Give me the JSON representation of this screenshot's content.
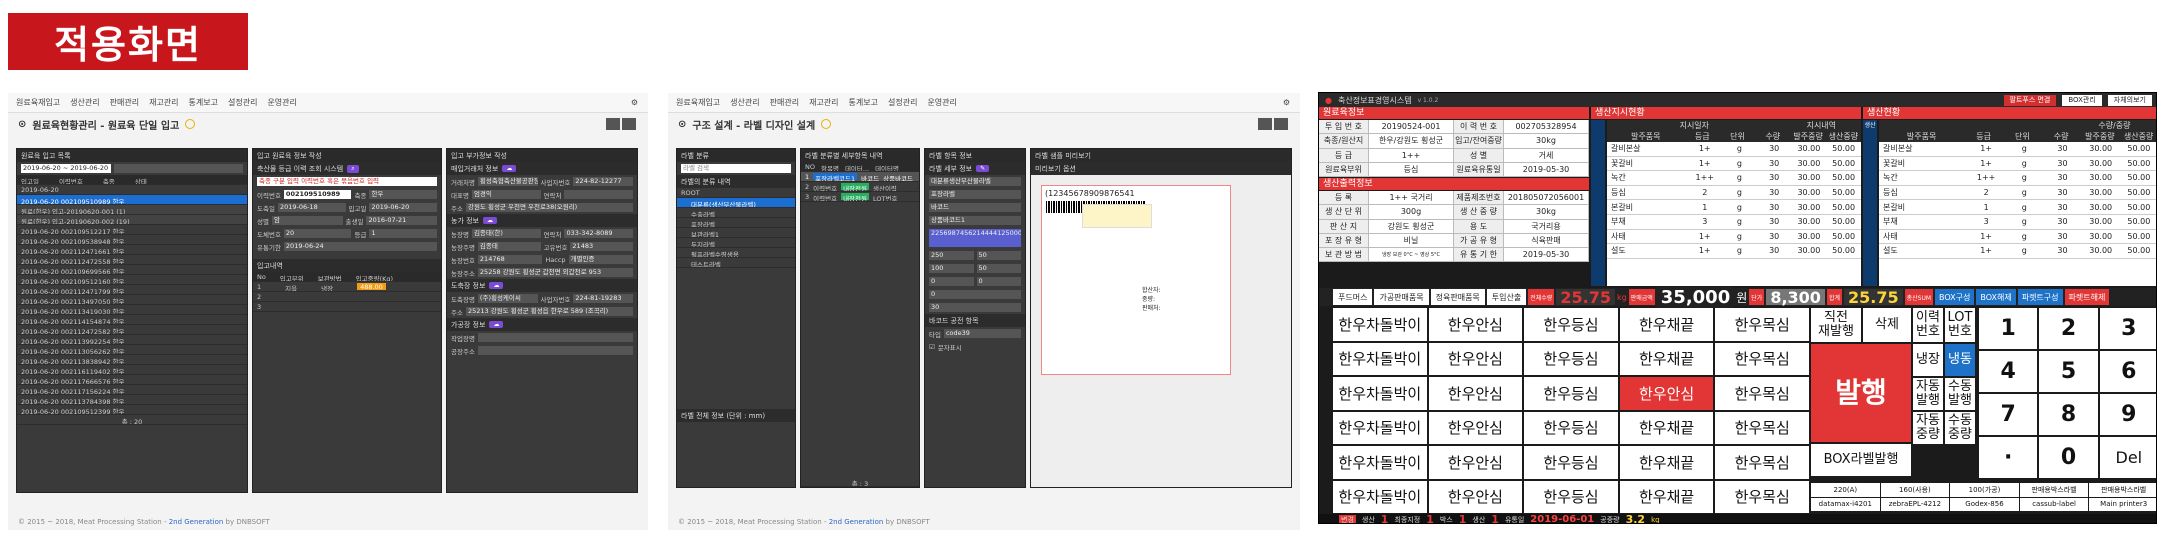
{
  "heading": "적용화면",
  "shot1": {
    "nav": [
      "원료육재입고",
      "생산관리",
      "판매관리",
      "재고관리",
      "통계보고",
      "설정관리",
      "운영관리"
    ],
    "title": "원료육현황관리 - 원료육 단일 입고",
    "left_title": "원료육 입고 목록",
    "date_range": "2019-06-20 ~ 2019-06-20",
    "cols": [
      "입고일",
      "이력번호",
      "축종",
      "상태"
    ],
    "rows": [
      "2019-06-20",
      "2019-06-20   002109510989   한우",
      "원료(한우) 입고-20190620-001 (1)",
      "원료(한우) 입고-20190620-002 (19)",
      "2019-06-20   002109512217   한우",
      "2019-06-20   002109538948   한우",
      "2019-06-20   002112471661   한우",
      "2019-06-20   002112472558   한우",
      "2019-06-20   002109699566   한우",
      "2019-06-20   002109512160   한우",
      "2019-06-20   002112471799   한우",
      "2019-06-20   002113497050   한우",
      "2019-06-20   002113419030   한우",
      "2019-06-20   002114154874   한우",
      "2019-06-20   002112472582   한우",
      "2019-06-20   002113992254   한우",
      "2019-06-20   002113056262   한우",
      "2019-06-20   002113838942   한우",
      "2019-06-20   002116119402   한우",
      "2019-06-20   002117666576   한우",
      "2019-06-20   002117156224   한우",
      "2019-06-20   002113784398   한우",
      "2019-06-20   002109512399   한우"
    ],
    "total": "총 : 20",
    "mid_title": "입고 원료육 정보 작성",
    "mid_sub": "축산물 등급 이력 조회 시스템",
    "search_hint": "축종 구분 입력 이력번호 혹은 묶음번호 입력",
    "trace_no": "002109510989",
    "fields": [
      [
        "이력번호",
        "002109510989",
        "축종",
        "한우"
      ],
      [
        "도축일",
        "2019-06-18",
        "입고일",
        "2019-06-20"
      ],
      [
        "성별",
        "암",
        "출생일",
        "2016-07-21"
      ],
      [
        "도체번호",
        "20",
        "등급",
        "1"
      ],
      [
        "유통기한",
        "2019-06-24",
        "",
        " "
      ]
    ],
    "lines_head": [
      "No",
      "입고부위",
      "보관방법",
      "입고중량(Kg)"
    ],
    "lines": [
      [
        "1",
        "지육",
        "냉장",
        "488.00"
      ],
      [
        "2",
        "",
        "",
        " "
      ],
      [
        "3",
        "",
        "",
        ""
      ]
    ],
    "right_title": "입고 부가정보 작성",
    "r1": "매입거래처 정보",
    "r2": "농가 정보",
    "r3": "도축장 정보",
    "r4": "가공장 정보",
    "rfields": [
      [
        "거래처명",
        "횡성축협축산물공판장",
        "사업자번호",
        "224-82-12277"
      ],
      [
        "대표명",
        "엄경익",
        "연락처",
        ""
      ],
      [
        "주소",
        "강원도 횡성군 우천면 우천로38(오원리)",
        "",
        " "
      ],
      [
        "농장명",
        "김종태(한)",
        "연락처",
        "033-342-8089"
      ],
      [
        "농장주명",
        "김종태",
        "고유번호",
        "21483"
      ],
      [
        "농장번호",
        "214768",
        "Haccp",
        "개별인증"
      ],
      [
        "농장주소",
        "25258 강원도 횡성군 갑천면 외갑천로 953",
        "",
        " "
      ],
      [
        "도축장명",
        "(주)횡성케이씨",
        "사업자번호",
        "224-81-19283"
      ],
      [
        "주소",
        "25213 강원도 횡성군 횡성읍 한우로 589 (조곡리)",
        "",
        " "
      ],
      [
        "작업장명",
        "",
        "",
        ""
      ],
      [
        "공장주소",
        "",
        "",
        ""
      ]
    ],
    "footer_pre": "© 2015 ~ 2018, Meat Processing Station - ",
    "footer_brand": "2nd Generation",
    "footer_post": " by DNBSOFT"
  },
  "shot2": {
    "nav": [
      "원료육재입고",
      "생산관리",
      "판매관리",
      "재고관리",
      "통계보고",
      "설정관리",
      "운영관리"
    ],
    "title": "구조 설계 - 라벨 디자인 설계",
    "p1": "라벨 분류",
    "search": "라벨 검색",
    "p1b": "라벨의 분류 내역",
    "tree": [
      "ROOT",
      "대분류(생산부산물라벨)",
      "수출라벨",
      "포장라벨",
      "보관라벨1",
      "두지라벨",
      "펄프라벨수령생용",
      "테스트라벨"
    ],
    "p2": "라벨 분류별 세부항목 내역",
    "p2cols": [
      "NO",
      "항목명",
      "데이터...",
      "데이터명"
    ],
    "p2rows": [
      [
        "1",
        "포장라벨코드1",
        "바코드",
        "상품바코드"
      ],
      [
        "2",
        "이력번호",
        "내장전원",
        "생산이력"
      ],
      [
        "3",
        "이력번호",
        "내장전원",
        "LOT번호"
      ]
    ],
    "p3": "라벨 항목 정보",
    "p3b": "라벨 세부 정보",
    "p3fields": [
      "대분류생산부산물라벨",
      "포장라벨",
      "바코드",
      "상품바코드1",
      "2256987456214444125000",
      "250",
      "100",
      "0",
      "0",
      "30",
      "50",
      "50",
      "0",
      "code39"
    ],
    "p3f": "바코드 공전 항목",
    "p3type": "타입",
    "p3show": "문자표시",
    "p4": "라벨 샘플 미리보기",
    "p4sub": "미리보기 옵션",
    "barcode": "(12345678909876541",
    "sample": [
      "합산자:",
      "중량:",
      "판매처:"
    ],
    "pgrid": "라벨 전체 정보 (단위 : mm)",
    "count": "총 : 3",
    "footer_pre": "© 2015 ~ 2018, Meat Processing Station - ",
    "footer_brand": "2nd Generation",
    "footer_post": " by DNBSOFT"
  },
  "shot3": {
    "title": "축산정보표경영시스템",
    "ver": "v 1.0.2",
    "btn_user": "팔트푸스 면결",
    "btn_box": "BOX관리",
    "btn_save": "자체의보기",
    "sec_raw": "원료육정보",
    "sec_plan": "생산지시현황",
    "sec_prod": "생산현황",
    "sec_out": "생산출력정보",
    "raw": [
      [
        "투 입 번 호",
        "20190524-001",
        "이 력 번 호",
        "002705328954"
      ],
      [
        "축종/원산지",
        "한우/강원도 횡성군",
        "입고/잔여중량",
        "30kg"
      ],
      [
        "등    급",
        "1++",
        "성      별",
        "거세"
      ],
      [
        "원료육부위",
        "등심",
        "원료육유통일",
        "2019-05-30"
      ]
    ],
    "out": [
      [
        "등    록",
        "1++ 국거리",
        "제품제조번호",
        "201805072056001"
      ],
      [
        "생 산 단 위",
        "300g",
        "생 산 중 량",
        "30kg"
      ],
      [
        "판    산  지",
        "강원도 횡성군",
        "용     도",
        "국거리용"
      ],
      [
        "포 장 유 형",
        "비닐",
        "가 공 유 형",
        "식육판매"
      ],
      [
        "보 관 방 법",
        "냉장 보관 0°C ~ 영상 5°C",
        "유 통 기 한",
        "2019-05-30"
      ]
    ],
    "plan_cols": [
      "발주품목",
      "등급",
      "단위",
      "수량",
      "발주중량",
      "생산중량"
    ],
    "plan": [
      [
        "갈비본살",
        "1+",
        "g",
        "30",
        "30.00",
        "50.00"
      ],
      [
        "꽃갈비",
        "1+",
        "g",
        "30",
        "30.00",
        "50.00"
      ],
      [
        "녹간",
        "1++",
        "g",
        "30",
        "30.00",
        "50.00"
      ],
      [
        "등심",
        "2",
        "g",
        "30",
        "30.00",
        "50.00"
      ],
      [
        "본갈비",
        "1",
        "g",
        "30",
        "30.00",
        "50.00"
      ],
      [
        "부채",
        "3",
        "g",
        "30",
        "30.00",
        "50.00"
      ],
      [
        "사태",
        "1+",
        "g",
        "30",
        "30.00",
        "50.00"
      ],
      [
        "설도",
        "1+",
        "g",
        "30",
        "30.00",
        "50.00"
      ]
    ],
    "plan_head": [
      "지시일자",
      "지시내역"
    ],
    "prod_head": [
      "수량/중량"
    ],
    "side_left": "생산",
    "tabs": [
      "푸드머스",
      "가공판매품목",
      "정육판매품목",
      "투입산출"
    ],
    "sum_label1": "전체수량",
    "sum1": "25.75",
    "unit1": "kg",
    "sum_label2": "판매금액",
    "sum2": "35,000",
    "unit2": "원",
    "sum_label3": "단가",
    "sum3": "8,300",
    "sum_label4": "합계",
    "sum4": "25.75",
    "sum_label5": "총산SUM",
    "tab_btns": [
      "BOX구성",
      "BOX해제",
      "파렛트구성",
      "파렛트해제"
    ],
    "products": [
      [
        "한우차돌박이",
        "한우안심",
        "한우등심",
        "한우채끝",
        "한우목심"
      ],
      [
        "한우차돌박이",
        "한우안심",
        "한우등심",
        "한우채끝",
        "한우목심"
      ],
      [
        "한우차돌박이",
        "한우안심",
        "한우등심",
        "한우안심",
        "한우목심"
      ],
      [
        "한우차돌박이",
        "한우안심",
        "한우등심",
        "한우채끝",
        "한우목심"
      ],
      [
        "한우차돌박이",
        "한우안심",
        "한우등심",
        "한우채끝",
        "한우목심"
      ],
      [
        "한우차돌박이",
        "한우안심",
        "한우등심",
        "한우채끝",
        "한우목심"
      ]
    ],
    "ctrl": {
      "direct": "직전\n재발행",
      "delete": "삭제",
      "trace": "이력\n번호",
      "lot": "LOT\n번호",
      "issue": "발행",
      "chill": "냉장",
      "freeze": "냉동",
      "auto_issue": "자동\n발행",
      "manual_issue": "수동\n발행",
      "auto_weight": "자동\n중량",
      "manual_weight": "수동\n중량",
      "box": "BOX라벨발행"
    },
    "keypad": [
      "1",
      "2",
      "3",
      "4",
      "5",
      "6",
      "7",
      "8",
      "9",
      "·",
      "0",
      "Del"
    ],
    "printers": [
      "220(A)",
      "160(사용)",
      "100(가공)",
      "판매용박스라벨",
      "판매용박스라벨",
      "datamax-i4201",
      "zebraEPL-4212",
      "Godex-856",
      "cassub-label",
      "Main printer3"
    ],
    "status": [
      [
        "변경",
        "작업"
      ],
      [
        "생산",
        "수량"
      ],
      "1",
      [
        "최종지정",
        "정보판정"
      ],
      "1",
      [
        "박스",
        "수량"
      ],
      "1",
      [
        "생산",
        "용기"
      ],
      "1",
      [
        "유통일"
      ],
      "2019-06-01",
      [
        "공중량"
      ],
      "3.2",
      "kg"
    ]
  }
}
